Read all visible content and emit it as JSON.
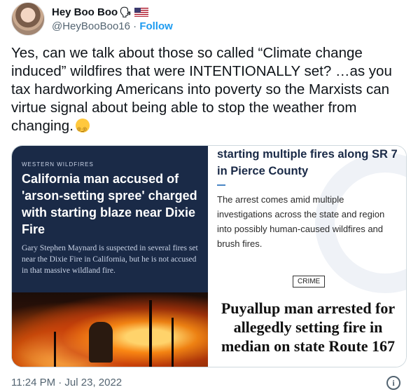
{
  "author": {
    "display_name": "Hey Boo Boo",
    "handle": "@HeyBooBoo16",
    "separator": "·",
    "follow_label": "Follow",
    "name_emojis": [
      "speaking-head-icon",
      "us-flag-icon"
    ]
  },
  "tweet": {
    "text": "Yes, can we talk about those so called “Climate change induced” wildfires that were INTENTIONALLY set? …as you tax hardworking Americans into poverty so the Marxists can virtue signal about being able to stop the weather from changing.",
    "trailing_emoji": "dizzy-face-icon"
  },
  "media": {
    "left_card": {
      "kicker": "WESTERN WILDFIRES",
      "headline": "California man accused of 'arson-setting spree' charged with starting blaze near Dixie Fire",
      "subhead": "Gary Stephen Maynard is suspected in several fires set near the Dixie Fire in California, but he is not accused in that massive wildland fire."
    },
    "right_card": {
      "headline": "starting multiple fires along SR 7 in Pierce County",
      "body": "The arrest comes amid multiple investigations across the state and region into possibly human-caused wildfires and brush fires.",
      "tag": "CRIME",
      "big_headline": "Puyallup man arrested for allegedly setting fire in median on state Route 167"
    }
  },
  "footer": {
    "timestamp": "11:24 PM · Jul 23, 2022",
    "info_icon": "info-icon"
  },
  "colors": {
    "link_blue": "#1d9bf0",
    "muted_gray": "#536471",
    "card_navy": "#1a2a47"
  }
}
